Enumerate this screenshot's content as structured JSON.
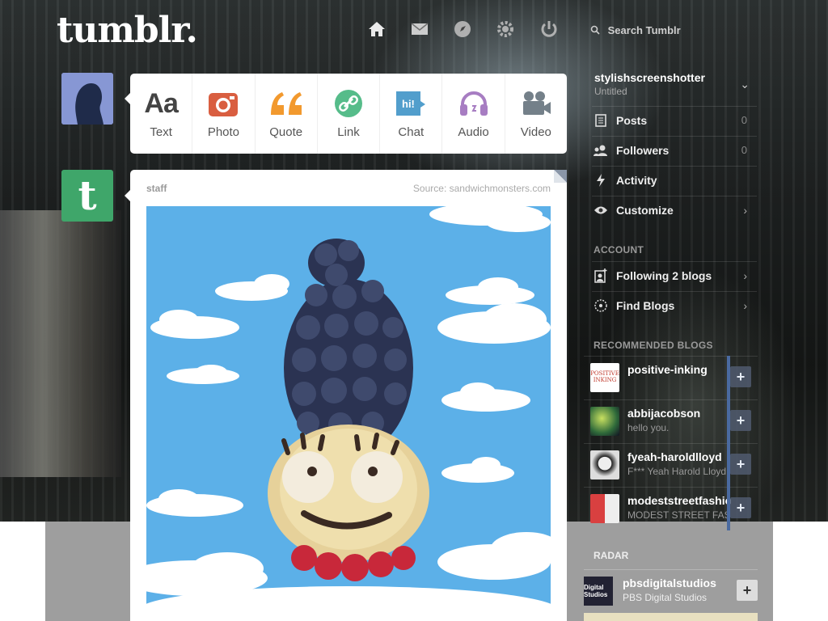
{
  "header": {
    "logo": "tumblr.",
    "search_placeholder": "Search Tumblr",
    "nav_icons": [
      "home-icon",
      "mail-icon",
      "compass-icon",
      "gear-icon",
      "power-icon"
    ]
  },
  "post_types": [
    {
      "label": "Text",
      "icon": "text-icon",
      "color": "#444444"
    },
    {
      "label": "Photo",
      "icon": "camera-icon",
      "color": "#d95e40"
    },
    {
      "label": "Quote",
      "icon": "quote-icon",
      "color": "#f2992e"
    },
    {
      "label": "Link",
      "icon": "link-icon",
      "color": "#56bc8a"
    },
    {
      "label": "Chat",
      "icon": "chat-icon",
      "color": "#529ecc"
    },
    {
      "label": "Audio",
      "icon": "headphones-icon",
      "color": "#a77dc2"
    },
    {
      "label": "Video",
      "icon": "video-camera-icon",
      "color": "#748089"
    }
  ],
  "post": {
    "author": "staff",
    "source": "Source: sandwichmonsters.com"
  },
  "sidebar": {
    "blog_name": "stylishscreenshotter",
    "blog_title": "Untitled",
    "items": [
      {
        "label": "Posts",
        "count": "0",
        "icon": "document-icon"
      },
      {
        "label": "Followers",
        "count": "0",
        "icon": "followers-icon"
      },
      {
        "label": "Activity",
        "count": "",
        "icon": "lightning-icon"
      },
      {
        "label": "Customize",
        "count": "",
        "icon": "eye-icon"
      }
    ],
    "account_heading": "ACCOUNT",
    "account_items": [
      {
        "label": "Following 2 blogs",
        "icon": "following-icon"
      },
      {
        "label": "Find Blogs",
        "icon": "compass-icon"
      }
    ],
    "recommended_heading": "RECOMMENDED BLOGS",
    "recommended": [
      {
        "name": "positive-inking",
        "desc": "",
        "thumb_text": "POSITIVE INKING",
        "thumb_color": "#ffffff"
      },
      {
        "name": "abbijacobson",
        "desc": "hello you.",
        "thumb_text": "",
        "thumb_color": "#3a8a3a"
      },
      {
        "name": "fyeah-haroldlloyd",
        "desc": "F*** Yeah Harold Lloyd",
        "thumb_text": "",
        "thumb_color": "#cccccc"
      },
      {
        "name": "modeststreetfashion",
        "desc": "MODEST STREET FASHION",
        "thumb_text": "",
        "thumb_color": "#d94040"
      }
    ],
    "radar_heading": "RADAR",
    "radar": {
      "name": "pbsdigitalstudios",
      "desc": "PBS Digital Studios",
      "thumb_text": "Digital Studios"
    }
  }
}
